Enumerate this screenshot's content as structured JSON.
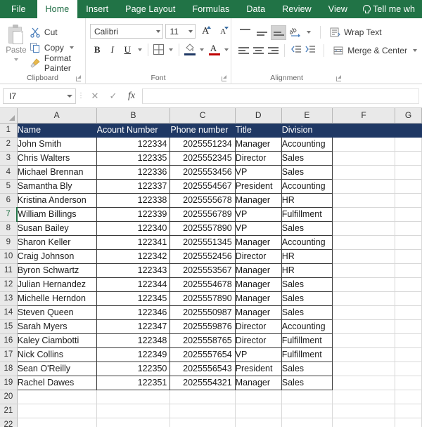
{
  "ribbon": {
    "tabs": [
      {
        "label": "File",
        "active": false
      },
      {
        "label": "Home",
        "active": true
      },
      {
        "label": "Insert",
        "active": false
      },
      {
        "label": "Page Layout",
        "active": false
      },
      {
        "label": "Formulas",
        "active": false
      },
      {
        "label": "Data",
        "active": false
      },
      {
        "label": "Review",
        "active": false
      },
      {
        "label": "View",
        "active": false
      }
    ],
    "tell_me": "Tell me wh",
    "groups": {
      "clipboard": {
        "label": "Clipboard",
        "paste": "Paste",
        "cut": "Cut",
        "copy": "Copy",
        "format_painter": "Format Painter"
      },
      "font": {
        "label": "Font",
        "font_name": "Calibri",
        "font_size": "11",
        "bold": "B",
        "italic": "I",
        "underline": "U"
      },
      "alignment": {
        "label": "Alignment",
        "wrap_text": "Wrap Text",
        "merge_center": "Merge & Center"
      }
    }
  },
  "formula_bar": {
    "name_box": "I7",
    "formula": ""
  },
  "grid": {
    "columns": [
      "A",
      "B",
      "C",
      "D",
      "E",
      "F",
      "G"
    ],
    "selected_cell": "I7",
    "selected_row": 7,
    "headers": [
      "Name",
      "Acount Number",
      "Phone number",
      "Title",
      "Division"
    ],
    "rows": [
      {
        "n": 2,
        "cells": [
          "John Smith",
          "122334",
          "2025551234",
          "Manager",
          "Accounting"
        ]
      },
      {
        "n": 3,
        "cells": [
          "Chris Walters",
          "122335",
          "2025552345",
          "Director",
          "Sales"
        ]
      },
      {
        "n": 4,
        "cells": [
          "Michael Brennan",
          "122336",
          "2025553456",
          "VP",
          "Sales"
        ]
      },
      {
        "n": 5,
        "cells": [
          "Samantha Bly",
          "122337",
          "2025554567",
          "President",
          "Accounting"
        ]
      },
      {
        "n": 6,
        "cells": [
          "Kristina Anderson",
          "122338",
          "2025555678",
          "Manager",
          "HR"
        ]
      },
      {
        "n": 7,
        "cells": [
          "William Billings",
          "122339",
          "2025556789",
          "VP",
          "Fulfillment"
        ]
      },
      {
        "n": 8,
        "cells": [
          "Susan Bailey",
          "122340",
          "2025557890",
          "VP",
          "Sales"
        ]
      },
      {
        "n": 9,
        "cells": [
          "Sharon Keller",
          "122341",
          "2025551345",
          "Manager",
          "Accounting"
        ]
      },
      {
        "n": 10,
        "cells": [
          "Craig Johnson",
          "122342",
          "2025552456",
          "Director",
          "HR"
        ]
      },
      {
        "n": 11,
        "cells": [
          "Byron Schwartz",
          "122343",
          "2025553567",
          "Manager",
          "HR"
        ]
      },
      {
        "n": 12,
        "cells": [
          "Julian Hernandez",
          "122344",
          "2025554678",
          "Manager",
          "Sales"
        ]
      },
      {
        "n": 13,
        "cells": [
          "Michelle Herndon",
          "122345",
          "2025557890",
          "Manager",
          "Sales"
        ]
      },
      {
        "n": 14,
        "cells": [
          "Steven Queen",
          "122346",
          "2025550987",
          "Manager",
          "Sales"
        ]
      },
      {
        "n": 15,
        "cells": [
          "Sarah Myers",
          "122347",
          "2025559876",
          "Director",
          "Accounting"
        ]
      },
      {
        "n": 16,
        "cells": [
          "Kaley Ciambotti",
          "122348",
          "2025558765",
          "Director",
          "Fulfillment"
        ]
      },
      {
        "n": 17,
        "cells": [
          "Nick Collins",
          "122349",
          "2025557654",
          "VP",
          "Fulfillment"
        ]
      },
      {
        "n": 18,
        "cells": [
          "Sean O'Reilly",
          "122350",
          "2025556543",
          "President",
          "Sales"
        ]
      },
      {
        "n": 19,
        "cells": [
          "Rachel Dawes",
          "122351",
          "2025554321",
          "Manager",
          "Sales"
        ]
      }
    ],
    "empty_rows": [
      20,
      21,
      22
    ],
    "numeric_columns": [
      1,
      2
    ]
  },
  "colors": {
    "ribbon_green": "#217346",
    "table_header": "#1f3864",
    "selection_green": "#217346",
    "header_gray": "#e9e9e9"
  }
}
